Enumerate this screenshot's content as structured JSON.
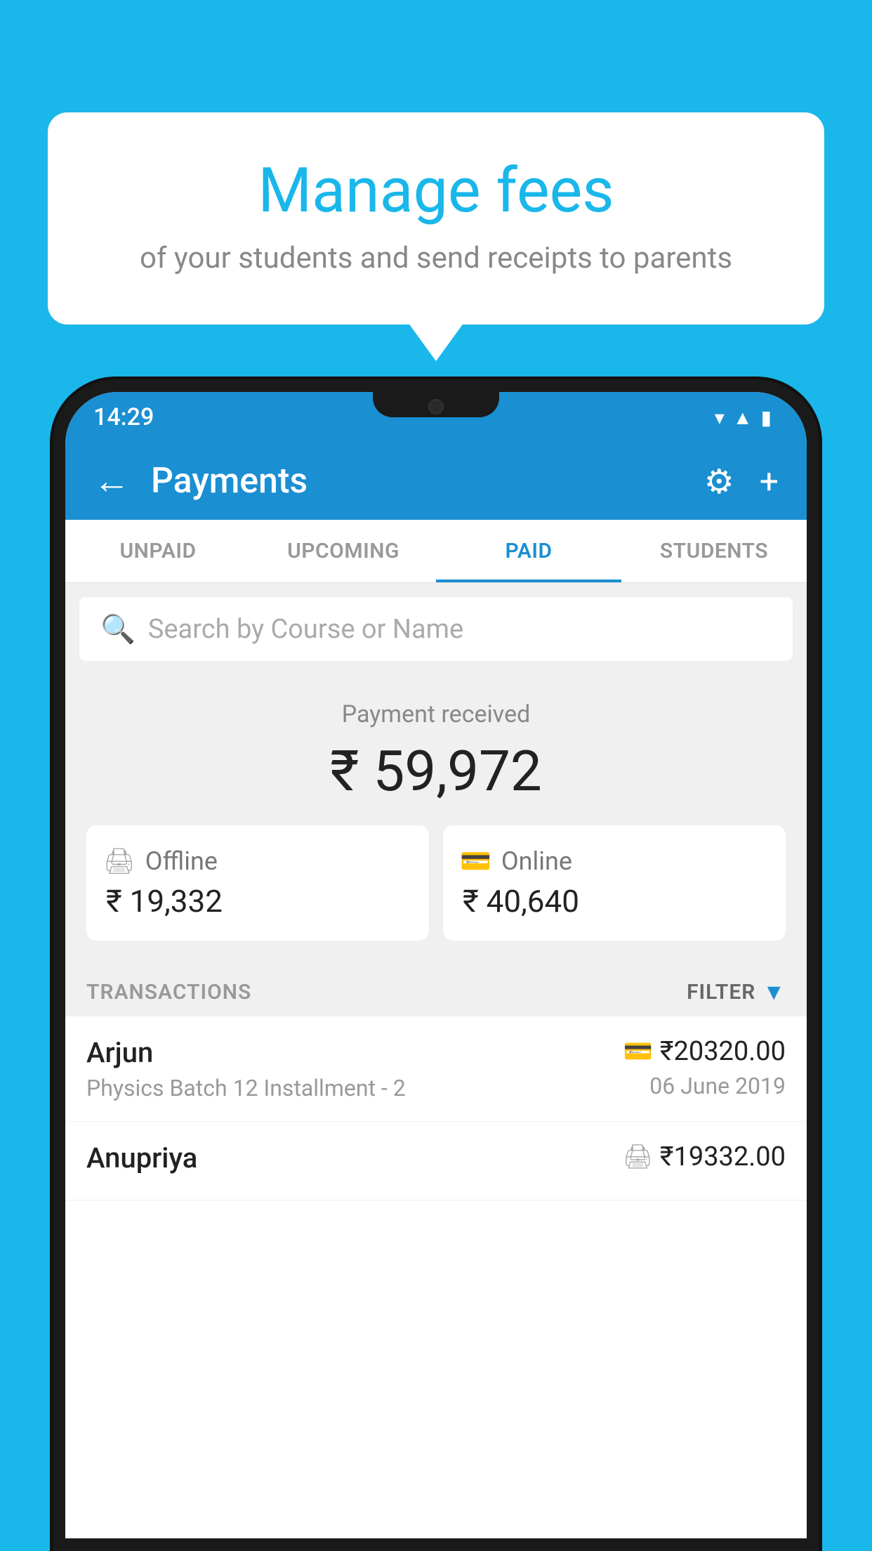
{
  "background_color": "#1ab7ea",
  "speech_bubble": {
    "title": "Manage fees",
    "subtitle": "of your students and send receipts to parents"
  },
  "status_bar": {
    "time": "14:29",
    "icons": [
      "wifi",
      "signal",
      "battery"
    ]
  },
  "app_bar": {
    "title": "Payments",
    "back_label": "←",
    "settings_label": "⚙",
    "add_label": "+"
  },
  "tabs": [
    {
      "label": "UNPAID",
      "active": false
    },
    {
      "label": "UPCOMING",
      "active": false
    },
    {
      "label": "PAID",
      "active": true
    },
    {
      "label": "STUDENTS",
      "active": false
    }
  ],
  "search": {
    "placeholder": "Search by Course or Name"
  },
  "payment_summary": {
    "label": "Payment received",
    "total": "₹ 59,972",
    "offline": {
      "type": "Offline",
      "amount": "₹ 19,332"
    },
    "online": {
      "type": "Online",
      "amount": "₹ 40,640"
    }
  },
  "transactions_header": {
    "label": "TRANSACTIONS",
    "filter_label": "FILTER"
  },
  "transactions": [
    {
      "name": "Arjun",
      "description": "Physics Batch 12 Installment - 2",
      "amount": "₹20320.00",
      "date": "06 June 2019",
      "payment_type": "online"
    },
    {
      "name": "Anupriya",
      "description": "",
      "amount": "₹19332.00",
      "date": "",
      "payment_type": "offline"
    }
  ]
}
